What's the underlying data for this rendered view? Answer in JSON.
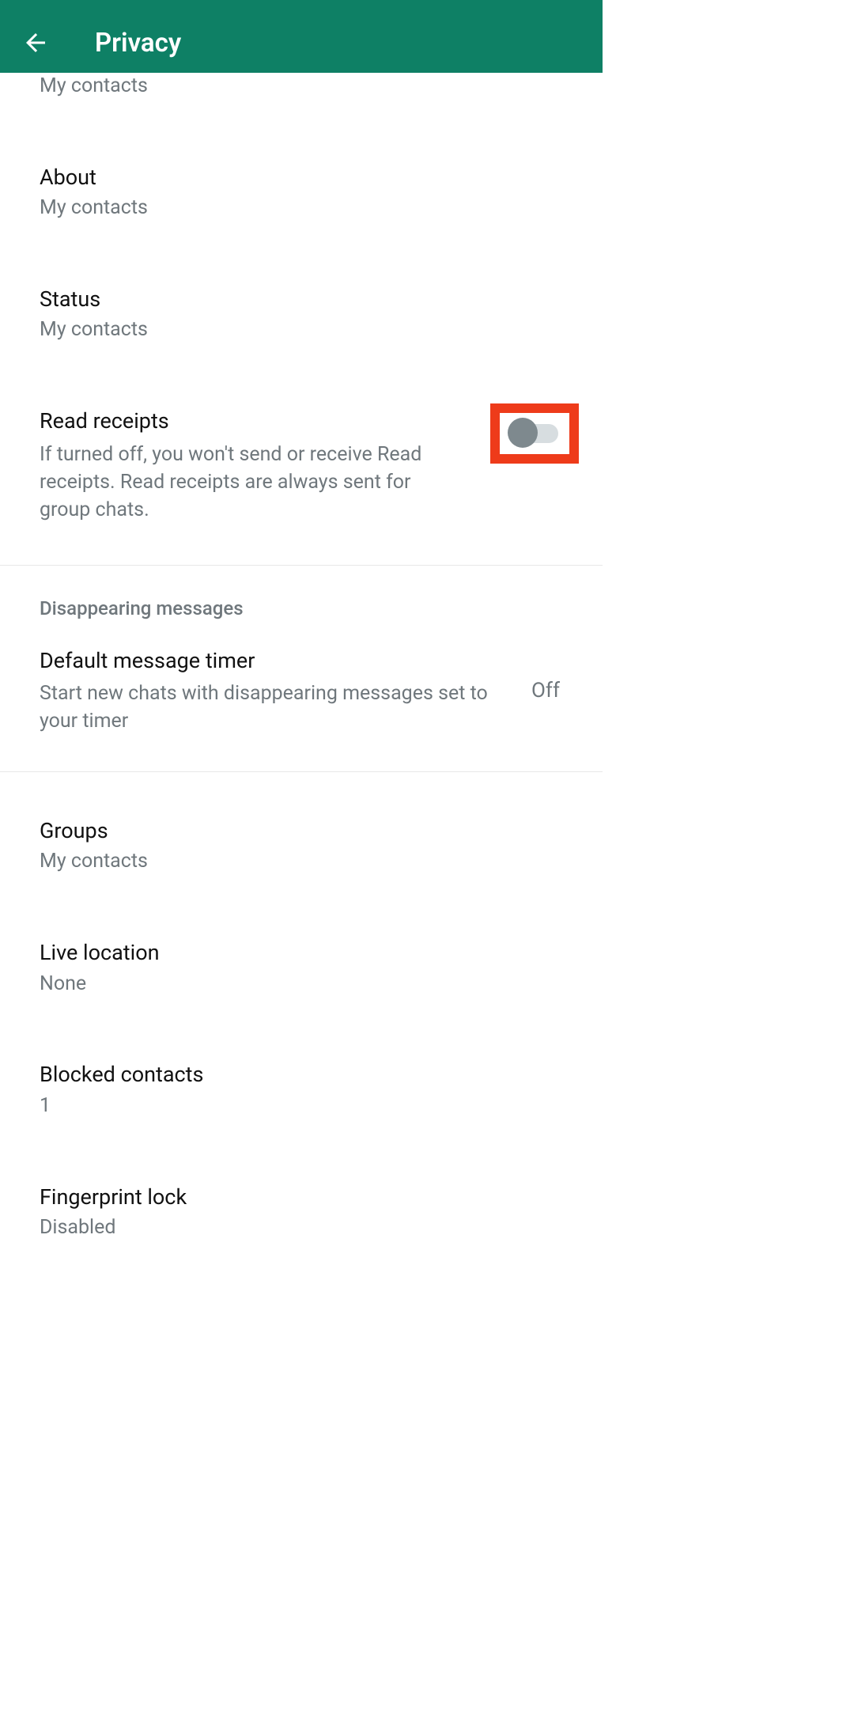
{
  "header": {
    "title": "Privacy"
  },
  "settings": {
    "partial_top": {
      "subtitle": "My contacts"
    },
    "about": {
      "title": "About",
      "subtitle": "My contacts"
    },
    "status": {
      "title": "Status",
      "subtitle": "My contacts"
    },
    "read_receipts": {
      "title": "Read receipts",
      "description": "If turned off, you won't send or receive Read receipts. Read receipts are always sent for group chats.",
      "enabled": false
    },
    "disappearing_section": {
      "label": "Disappearing messages"
    },
    "default_timer": {
      "title": "Default message timer",
      "description": "Start new chats with disappearing messages set to your timer",
      "value": "Off"
    },
    "groups": {
      "title": "Groups",
      "subtitle": "My contacts"
    },
    "live_location": {
      "title": "Live location",
      "subtitle": "None"
    },
    "blocked_contacts": {
      "title": "Blocked contacts",
      "subtitle": "1"
    },
    "fingerprint_lock": {
      "title": "Fingerprint lock",
      "subtitle": "Disabled"
    }
  }
}
